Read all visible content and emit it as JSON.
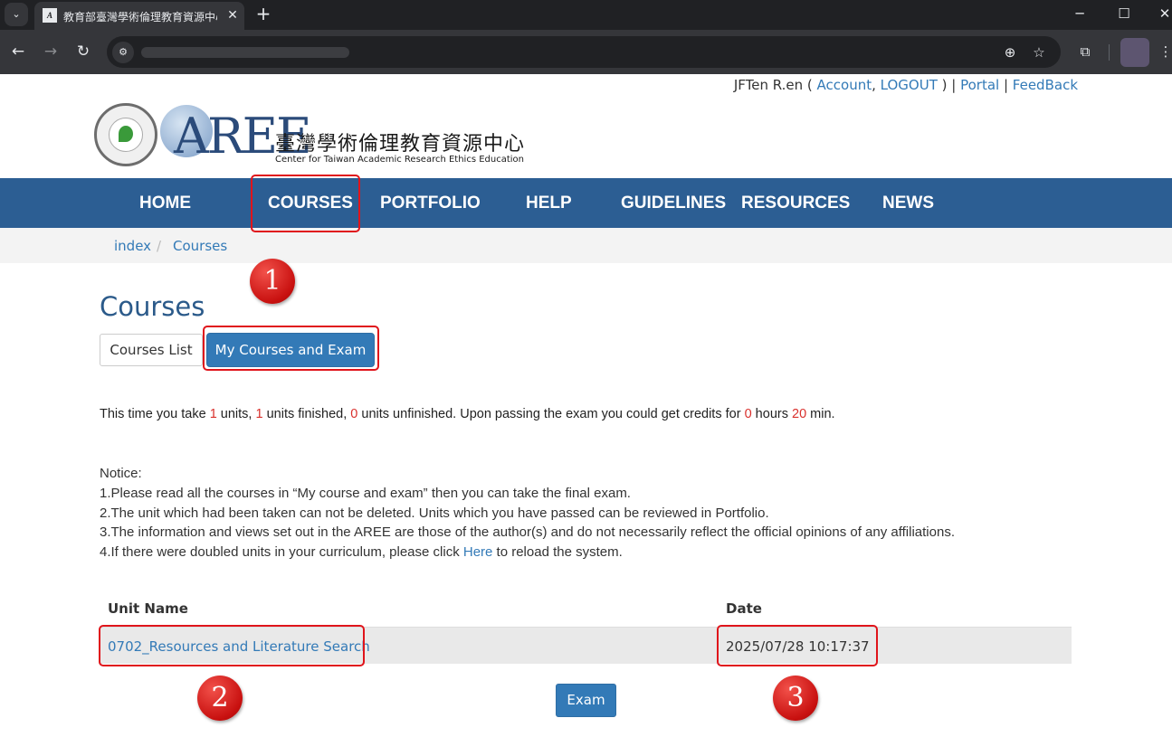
{
  "browser": {
    "tab_title": "教育部臺灣學術倫理教育資源中心",
    "new_tab_glyph": "+",
    "tab_close_glyph": "✕"
  },
  "header": {
    "user_name": "JFTen R.en",
    "account_label": "Account",
    "logout_label": "LOGOUT",
    "portal_label": "Portal",
    "feedback_label": "FeedBack"
  },
  "logo": {
    "wordmark": "AREE",
    "title_cn": "臺灣學術倫理教育資源中心",
    "title_en": "Center for Taiwan Academic Research Ethics Education"
  },
  "nav": {
    "items": [
      {
        "label": "HOME"
      },
      {
        "label": "COURSES"
      },
      {
        "label": "PORTFOLIO"
      },
      {
        "label": "HELP"
      },
      {
        "label": "GUIDELINES"
      },
      {
        "label": "RESOURCES"
      },
      {
        "label": "NEWS"
      }
    ]
  },
  "breadcrumb": {
    "items": [
      "index",
      "Courses"
    ],
    "separator": "/"
  },
  "page": {
    "title": "Courses",
    "tabs": [
      {
        "label": "Courses List"
      },
      {
        "label": "My Courses and Exam"
      }
    ]
  },
  "summary": {
    "prefix": "This time you take ",
    "units_taken": "1",
    "after_taken": " units, ",
    "units_finished": "1",
    "after_finished": " units finished, ",
    "units_unfinished": "0",
    "after_unfinished": " units unfinished. Upon passing the exam you could get credits for ",
    "hours": "0",
    "after_hours": " hours ",
    "minutes": "20",
    "after_minutes": " min."
  },
  "notice": {
    "heading": "Notice:",
    "line1": "1.Please read all the courses in “My course and exam” then you can take the final exam.",
    "line2": "2.The unit which had been taken can not be deleted. Units which you have passed can be reviewed in Portfolio.",
    "line3": "3.The information and views set out in the AREE are those of the author(s) and do not necessarily reflect the official opinions of any affiliations.",
    "line4_prefix": "4.If there were doubled units in your curriculum, please click ",
    "line4_link": "Here",
    "line4_suffix": " to reload the system."
  },
  "table": {
    "headers": [
      "Unit Name",
      "Date"
    ],
    "rows": [
      {
        "unit_name": "0702_Resources and Literature Search",
        "date": "2025/07/28 10:17:37"
      }
    ]
  },
  "exam_button_label": "Exam",
  "annotations": {
    "markers": [
      "1",
      "2",
      "3"
    ],
    "highlight_color": "#e0141b"
  },
  "colors": {
    "nav_bg": "#2c5e93",
    "link": "#337ab7",
    "primary_button": "#337ab7",
    "highlight_number": "#d9302c"
  }
}
